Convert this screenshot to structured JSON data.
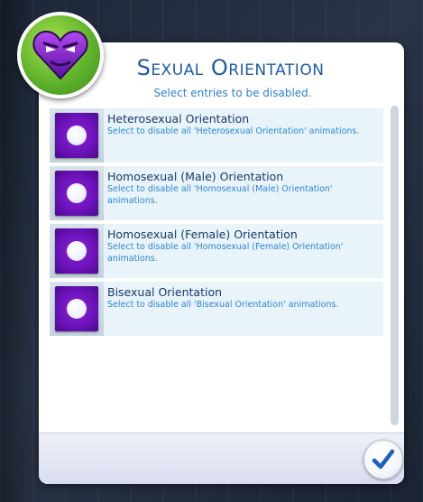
{
  "dialog": {
    "title": "Sexual Orientation",
    "subtitle": "Select entries to be disabled.",
    "emblem_icon": "purple-heart-icon",
    "ok_icon": "checkmark-icon",
    "accent_color": "#1d5ba8"
  },
  "items": [
    {
      "name": "Heterosexual Orientation",
      "description": "Select to disable all 'Heterosexual Orientation' animations."
    },
    {
      "name": "Homosexual (Male) Orientation",
      "description": "Select to disable all 'Homosexual (Male) Orientation' animations."
    },
    {
      "name": "Homosexual (Female) Orientation",
      "description": "Select to disable all 'Homosexual (Female) Orientation' animations."
    },
    {
      "name": "Bisexual Orientation",
      "description": "Select to disable all 'Bisexual Orientation' animations."
    }
  ]
}
